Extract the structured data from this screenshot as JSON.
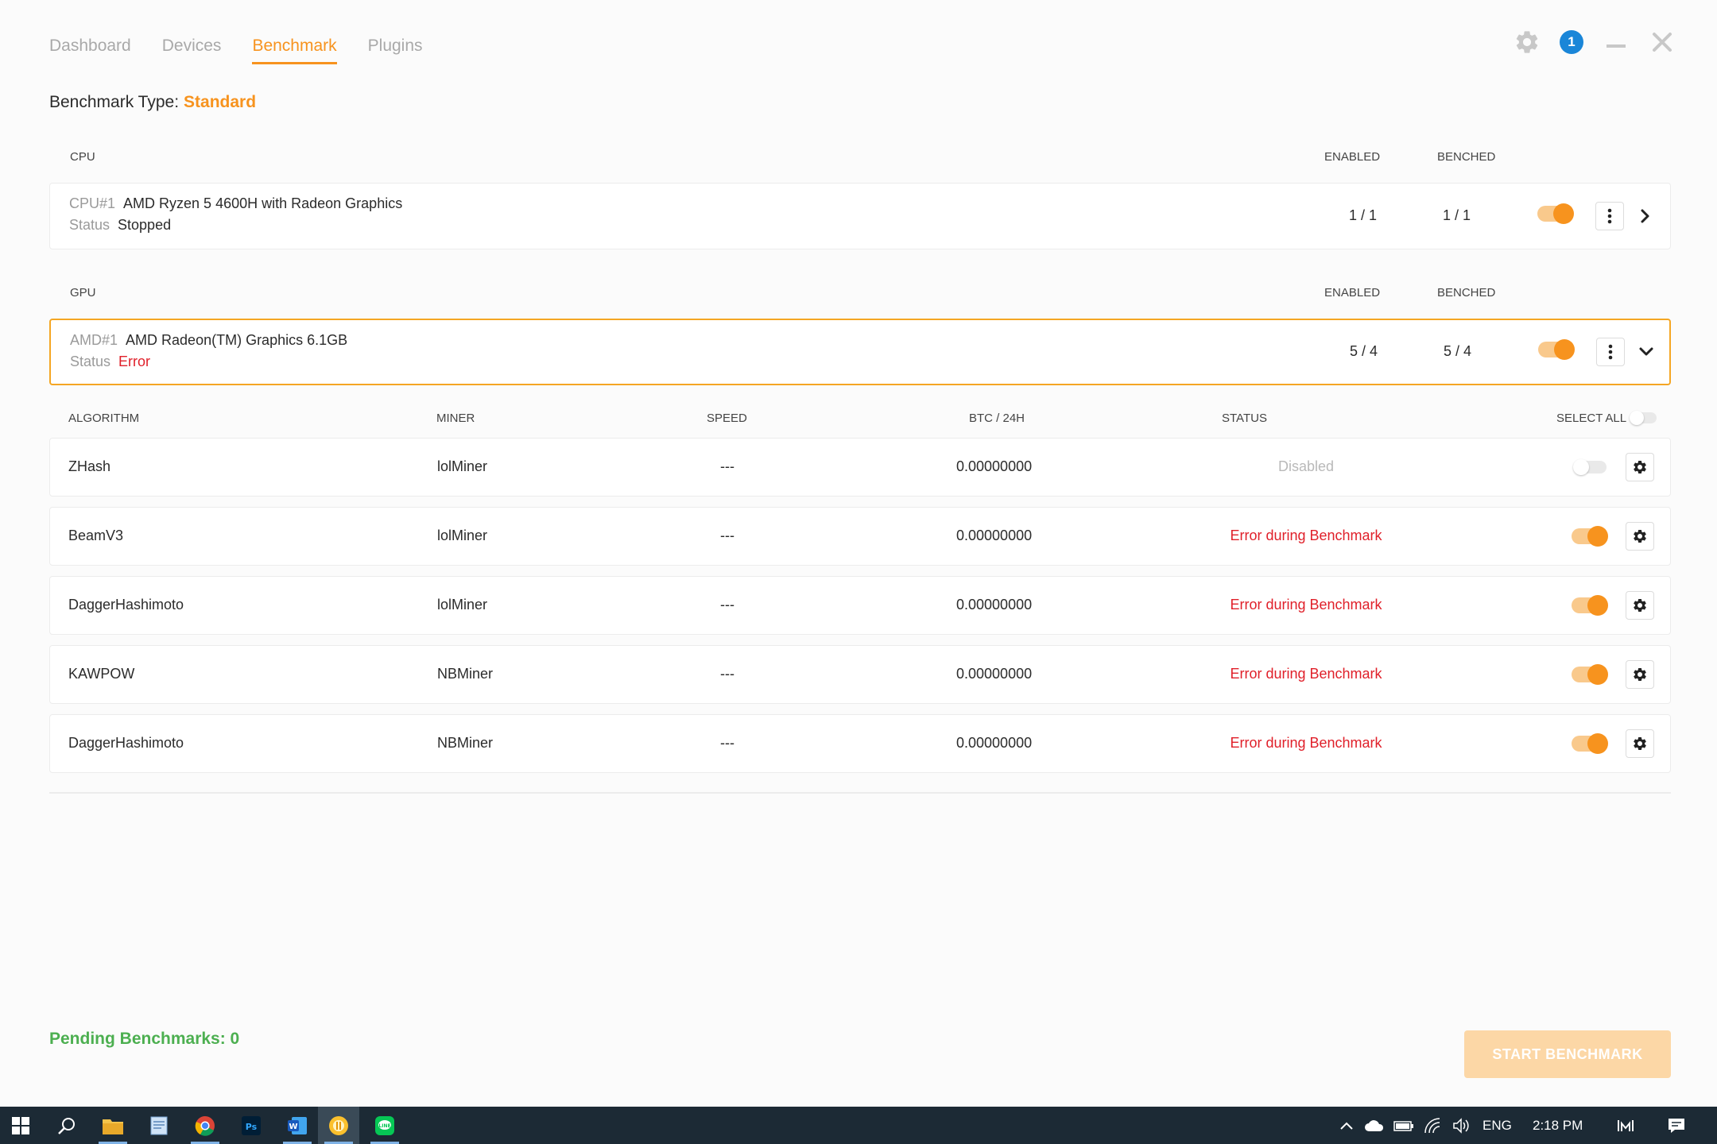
{
  "tabs": [
    {
      "label": "Dashboard",
      "active": false
    },
    {
      "label": "Devices",
      "active": false
    },
    {
      "label": "Benchmark",
      "active": true
    },
    {
      "label": "Plugins",
      "active": false
    }
  ],
  "window": {
    "notification_count": "1"
  },
  "benchmark_type": {
    "label": "Benchmark Type:",
    "value": "Standard"
  },
  "cpu_section": {
    "header": "CPU",
    "enabled_header": "ENABLED",
    "benched_header": "BENCHED",
    "device": {
      "id": "CPU#1",
      "name": "AMD Ryzen 5 4600H with Radeon Graphics",
      "status_label": "Status",
      "status": "Stopped",
      "enabled": "1 / 1",
      "benched": "1 / 1"
    }
  },
  "gpu_section": {
    "header": "GPU",
    "enabled_header": "ENABLED",
    "benched_header": "BENCHED",
    "device": {
      "id": "AMD#1",
      "name": "AMD Radeon(TM) Graphics 6.1GB",
      "status_label": "Status",
      "status": "Error",
      "enabled": "5 / 4",
      "benched": "5 / 4"
    }
  },
  "algo_table": {
    "headers": {
      "algorithm": "ALGORITHM",
      "miner": "MINER",
      "speed": "SPEED",
      "btc": "BTC / 24H",
      "status": "STATUS",
      "select_all": "SELECT ALL"
    },
    "rows": [
      {
        "algorithm": "ZHash",
        "miner": "lolMiner",
        "speed": "---",
        "btc": "0.00000000",
        "status": "Disabled",
        "enabled": false
      },
      {
        "algorithm": "BeamV3",
        "miner": "lolMiner",
        "speed": "---",
        "btc": "0.00000000",
        "status": "Error during Benchmark",
        "enabled": true
      },
      {
        "algorithm": "DaggerHashimoto",
        "miner": "lolMiner",
        "speed": "---",
        "btc": "0.00000000",
        "status": "Error during Benchmark",
        "enabled": true
      },
      {
        "algorithm": "KAWPOW",
        "miner": "NBMiner",
        "speed": "---",
        "btc": "0.00000000",
        "status": "Error during Benchmark",
        "enabled": true
      },
      {
        "algorithm": "DaggerHashimoto",
        "miner": "NBMiner",
        "speed": "---",
        "btc": "0.00000000",
        "status": "Error during Benchmark",
        "enabled": true
      }
    ]
  },
  "footer": {
    "pending": "Pending Benchmarks: 0",
    "start_button": "START BENCHMARK"
  },
  "taskbar": {
    "language": "ENG",
    "time": "2:18 PM"
  },
  "colors": {
    "accent": "#f7931e",
    "error": "#e0202a",
    "success": "#4caf50",
    "badge": "#1a86d8"
  }
}
